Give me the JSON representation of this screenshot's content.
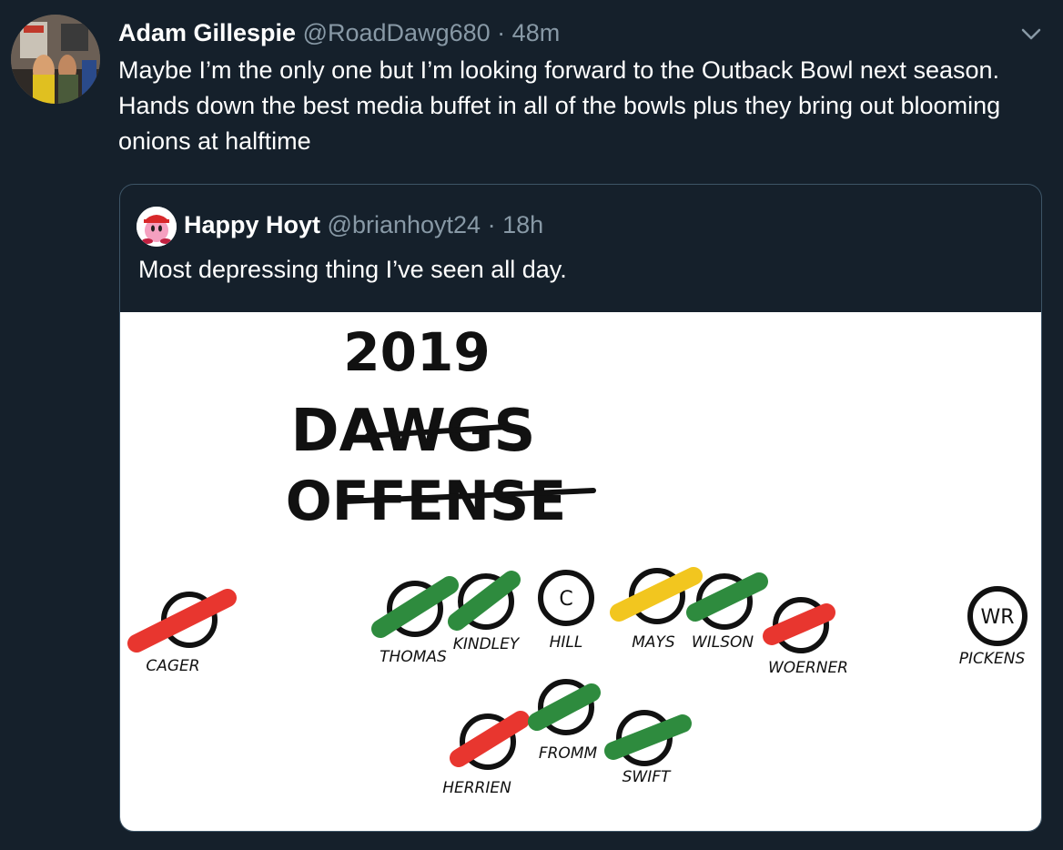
{
  "tweet": {
    "author_name": "Adam Gillespie",
    "handle": "@RoadDawg680",
    "separator": "·",
    "time": "48m",
    "text": "Maybe I’m the only one but I’m looking forward to the Outback Bowl next season. Hands down the best media buffet in all of the bowls plus they bring out blooming onions at halftime",
    "menu_icon": "chevron-down-icon"
  },
  "quoted_tweet": {
    "author_name": "Happy Hoyt",
    "handle": "@brianhoyt24",
    "separator": "·",
    "time": "18h",
    "text": "Most depressing thing I’ve seen all day."
  },
  "image": {
    "title_line1": "2019",
    "title_line2": "DAWGS",
    "title_line3": "OFFENSE",
    "colors": {
      "red": "#e8362f",
      "green": "#2e8b3e",
      "yellow": "#f2c61f"
    },
    "players": [
      {
        "label": "CAGER",
        "marker": "",
        "strike": "red"
      },
      {
        "label": "THOMAS",
        "marker": "",
        "strike": "green"
      },
      {
        "label": "KINDLEY",
        "marker": "",
        "strike": "green"
      },
      {
        "label": "HILL",
        "marker": "C",
        "strike": "none"
      },
      {
        "label": "MAYS",
        "marker": "",
        "strike": "yellow"
      },
      {
        "label": "WILSON",
        "marker": "",
        "strike": "green"
      },
      {
        "label": "WOERNER",
        "marker": "",
        "strike": "red"
      },
      {
        "label": "PICKENS",
        "marker": "WR",
        "strike": "none"
      },
      {
        "label": "HERRIEN",
        "marker": "",
        "strike": "red"
      },
      {
        "label": "FROMM",
        "marker": "",
        "strike": "green"
      },
      {
        "label": "SWIFT",
        "marker": "",
        "strike": "green"
      }
    ]
  }
}
